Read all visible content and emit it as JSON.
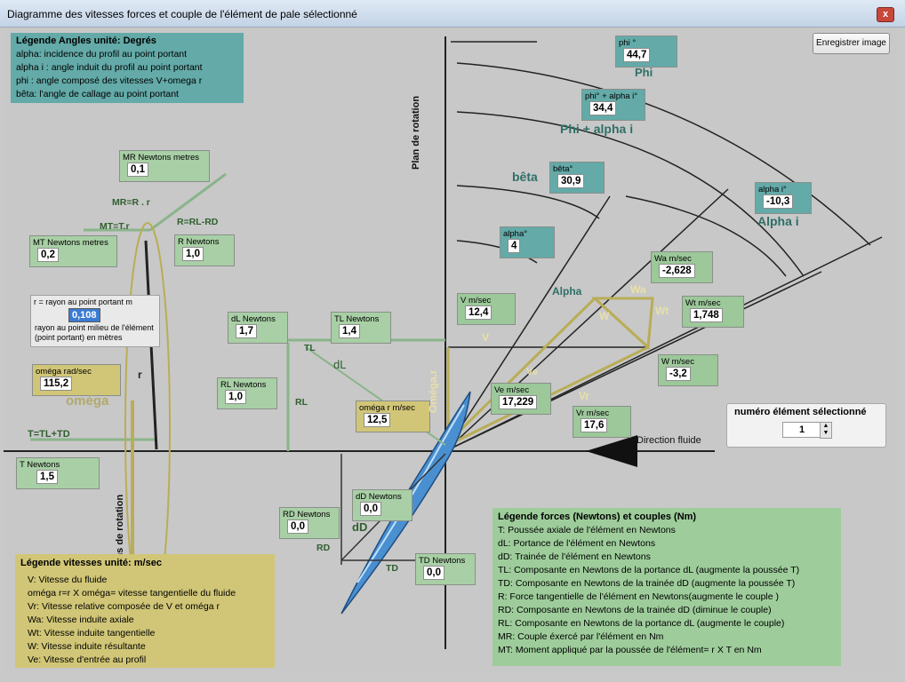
{
  "window": {
    "title": "Diagramme des vitesses forces et couple de l'élément de pale sélectionné",
    "close": "x"
  },
  "save_button": "Enregistrer image",
  "legend_angles": {
    "title": "Légende Angles unité: Degrés",
    "lines": [
      "alpha: incidence du profil au point portant",
      "alpha i : angle induit du profil  au point portant",
      "phi : angle composé des vitesses V+omega r",
      "bêta: l'angle de callage au point portant"
    ]
  },
  "fields": {
    "phi": {
      "label": "phi °",
      "value": "44,7"
    },
    "phi_alpha_i": {
      "label": "phi° + alpha i°",
      "value": "34,4"
    },
    "beta": {
      "label": "bêta°",
      "value": "30,9"
    },
    "alpha_i": {
      "label": "alpha i°",
      "value": "-10,3"
    },
    "alpha": {
      "label": "alpha°",
      "value": "4"
    },
    "wa": {
      "label": "Wa m/sec",
      "value": "-2,628"
    },
    "wt": {
      "label": "Wt m/sec",
      "value": "1,748"
    },
    "w": {
      "label": "W m/sec",
      "value": "-3,2"
    },
    "v": {
      "label": "V m/sec",
      "value": "12,4"
    },
    "ve": {
      "label": "Ve m/sec",
      "value": "17,229"
    },
    "vr": {
      "label": "Vr m/sec",
      "value": "17,6"
    },
    "omega_r": {
      "label": "oméga r m/sec",
      "value": "12,5"
    },
    "mr": {
      "label": "MR Newtons metres",
      "value": "0,1"
    },
    "mt": {
      "label": "MT Newtons metres",
      "value": "0,2"
    },
    "r": {
      "label": "R Newtons",
      "value": "1,0"
    },
    "radius": {
      "label": "r = rayon au point portant  m",
      "value": "0,108",
      "note": "rayon au point milieu de l'élément (point portant) en mètres"
    },
    "omega": {
      "label": "oméga rad/sec",
      "value": "115,2"
    },
    "dl": {
      "label": "dL Newtons",
      "value": "1,7"
    },
    "tl": {
      "label": "TL Newtons",
      "value": "1,4"
    },
    "rl": {
      "label": "RL Newtons",
      "value": "1,0"
    },
    "t": {
      "label": "T Newtons",
      "value": "1,5"
    },
    "rd": {
      "label": "RD Newtons",
      "value": "0,0"
    },
    "dd": {
      "label": "dD Newtons",
      "value": "0,0"
    },
    "td": {
      "label": "TD Newtons",
      "value": "0,0"
    }
  },
  "element_selector": {
    "label": "numéro élément sélectionné",
    "value": "1"
  },
  "diagram_labels": {
    "phi": "Phi",
    "phi_alpha_i": "Phi + alpha i",
    "beta": "bêta",
    "alpha_i": "Alpha i",
    "alpha": "Alpha",
    "wa": "Wa",
    "wt": "Wt",
    "w": "W",
    "v": "V",
    "ve": "Ve",
    "vr": "Vr",
    "plan_rotation": "Plan de rotation",
    "omega_r": "Oméga.r",
    "direction_fluide": "Direction fluide",
    "mr_eq": "MR=R . r",
    "mt_eq": "MT=T.r",
    "r_eq": "R=RL-RD",
    "omega": "oméga",
    "r": "r",
    "tl": "TL",
    "dl": "dL",
    "rl": "RL",
    "t_eq": "T=TL+TD",
    "sens_rotation": "Sens de rotation",
    "dd": "dD",
    "rd": "RD",
    "td": "TD"
  },
  "legend_vitesses": {
    "title": "Légende vitesses unité: m/sec",
    "lines": [
      "V: Vitesse du fluide",
      "oméga r=r X oméga= vitesse tangentielle du fluide",
      "Vr: Vitesse relative composée de V et oméga r",
      "Wa: Vitesse induite axiale",
      "Wt: Vitesse induite tangentielle",
      "W: Vitesse induite résultante",
      "Ve: Vitesse d'entrée au profil"
    ]
  },
  "legend_forces": {
    "title": "Légende forces (Newtons) et couples (Nm)",
    "lines": [
      "T: Poussée axiale de l'élément en Newtons",
      "dL: Portance de l'élément en Newtons",
      "dD: Trainée de l'élément en Newtons",
      "TL: Composante en Newtons de la portance dL (augmente la poussée T)",
      "TD: Composante en Newtons de la trainée dD (augmente la poussée T)",
      "R: Force tangentielle de l'élément en Newtons(augmente le couple )",
      "RD: Composante en Newtons de la trainée dD (diminue le couple)",
      "RL: Composante en Newtons de la portance dL (augmente le couple)",
      "MR: Couple éxercé par l'élément en Nm",
      "MT: Moment appliqué par la poussée de l'élément= r  X  T en Nm"
    ]
  }
}
